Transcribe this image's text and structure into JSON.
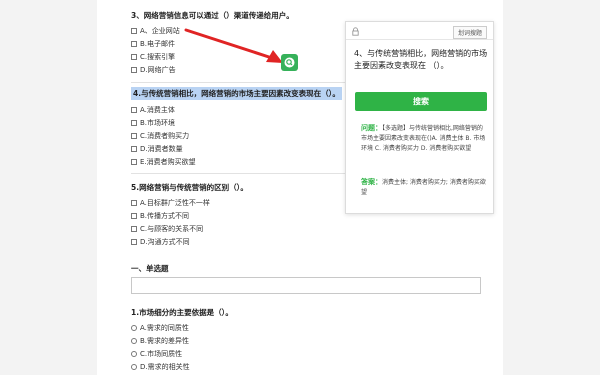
{
  "colors": {
    "accent": "#2fb346",
    "highlight": "#b9d3f3",
    "arrow": "#e02424"
  },
  "questions": {
    "q3": {
      "title": "3、网络营销信息可以通过（）渠道传递给用户。",
      "options": [
        "A、企业网站",
        "B.电子邮件",
        "C.搜索引擎",
        "D.网络广告"
      ]
    },
    "q4": {
      "title": "4.与传统营销相比，网络营销的市场主要因素改变表现在（）。",
      "options": [
        "A.消费主体",
        "B.市场环境",
        "C.消费者购买力",
        "D.消费者数量",
        "E.消费者购买欲望"
      ]
    },
    "q5": {
      "title": "5.网络营销与传统营销的区别（）。",
      "options": [
        "A.目标群广泛性不一样",
        "B.传播方式不同",
        "C.与顾客的关系不同",
        "D.沟通方式不同"
      ]
    },
    "section": {
      "title": "一、单选题"
    },
    "q1": {
      "title": "1.市场细分的主要依据是（）。",
      "options": [
        "A.需求的同质性",
        "B.需求的差异性",
        "C.市场同质性",
        "D.需求的相关性"
      ]
    }
  },
  "popup": {
    "feedback_label": "划词搜题",
    "query": "4、与传统营销相比，网络营销的市场主要因素改变表现在 （）。",
    "search_label": "搜索",
    "question_label": "问题：",
    "question_text": "【多选题】与传统营销相比,网络营销的市场主要因素改变表现在()A. 消费主体 B. 市场环境 C. 消费者购买力 D. 消费者购买欲望",
    "answer_label": "答案：",
    "answer_text": "消费主体; 消费者购买力; 消费者购买欲望"
  },
  "icons": {
    "fab": "search-icon",
    "lock": "lock-icon"
  }
}
